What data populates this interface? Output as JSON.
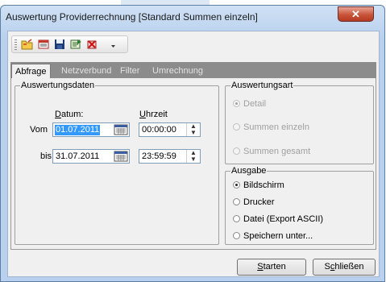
{
  "window": {
    "title": "Auswertung Providerrechnung [Standard Summen einzeln]",
    "close_glyph": "✕"
  },
  "toolbar": {
    "items": [
      "open-folder-icon",
      "list-icon",
      "save-icon",
      "export-icon",
      "delete-icon",
      "dropdown-arrow-icon"
    ]
  },
  "tabs": [
    {
      "label": "Abfrage",
      "active": true
    },
    {
      "label": "Netzverbund",
      "active": false
    },
    {
      "label": "Filter",
      "active": false
    },
    {
      "label": "Umrechnung",
      "active": false
    }
  ],
  "auswertungsdaten": {
    "group_label": "Auswertungsdaten",
    "datum_first": "D",
    "datum_rest": "atum:",
    "uhrzeit_first": "U",
    "uhrzeit_rest": "hrzeit",
    "vom_label": "Vom",
    "bis_label": "bis",
    "vom_date": "01.07.2011",
    "vom_time": "00:00:00",
    "bis_date": "31.07.2011",
    "bis_time": "23:59:59"
  },
  "auswertungsart": {
    "group_label": "Auswertungsart",
    "options": [
      {
        "label": "Detail",
        "selected": true,
        "enabled": false
      },
      {
        "label": "Summen einzeln",
        "selected": false,
        "enabled": false
      },
      {
        "label": "Summen gesamt",
        "selected": false,
        "enabled": false
      }
    ]
  },
  "ausgabe": {
    "group_label": "Ausgabe",
    "options": [
      {
        "label": "Bildschirm",
        "selected": true
      },
      {
        "label": "Drucker",
        "selected": false
      },
      {
        "label": "Datei (Export ASCII)",
        "selected": false
      },
      {
        "label": "Speichern unter...",
        "selected": false
      }
    ]
  },
  "buttons": {
    "start_first": "S",
    "start_rest": "tarten",
    "close_first": "S",
    "close_mid": "c",
    "close_rest": "hließen"
  },
  "colors": {
    "selection": "#3399ff",
    "tab_strip": "#8c8c8c",
    "close_button": "#c85439"
  }
}
